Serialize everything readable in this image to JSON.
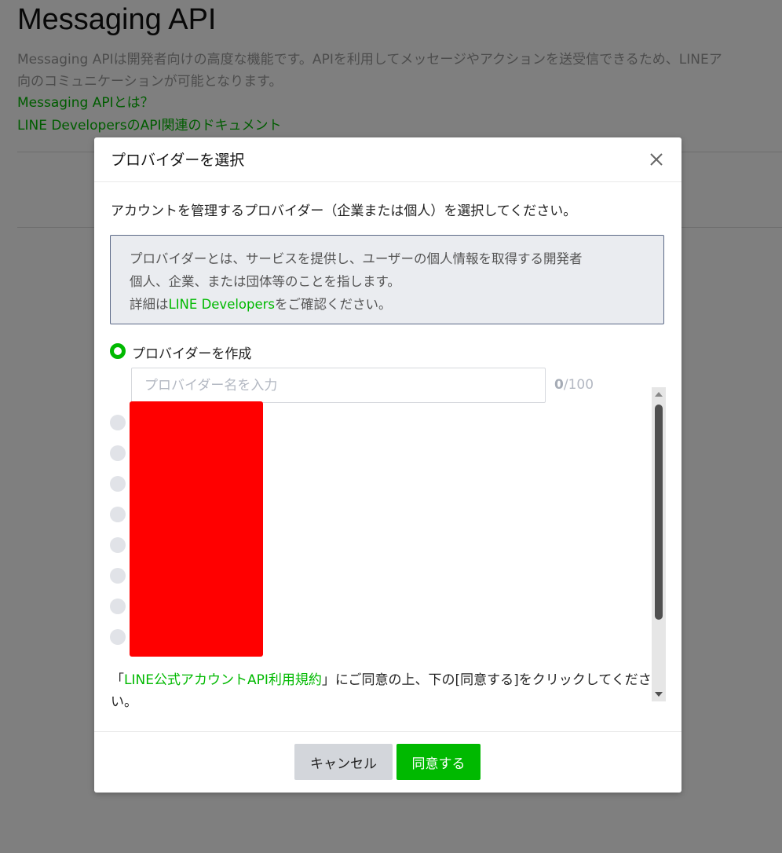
{
  "background": {
    "title": "Messaging API",
    "description_line1": "Messaging APIは開発者向けの高度な機能です。APIを利用してメッセージやアクションを送受信できるため、LINEア",
    "description_line2": "向のコミュニケーションが可能となります。",
    "links": [
      {
        "label": "Messaging APIとは？"
      },
      {
        "label": "LINE DevelopersのAPI関連のドキュメント"
      }
    ]
  },
  "modal": {
    "title": "プロバイダーを選択",
    "close_icon": "close-icon",
    "intro": "アカウントを管理するプロバイダー（企業または個人）を選択してください。",
    "info": {
      "line1": "プロバイダーとは、サービスを提供し、ユーザーの個人情報を取得する開発者",
      "line2": "個人、企業、または団体等のことを指します。",
      "line3_prefix": "詳細は",
      "line3_link": "LINE Developers",
      "line3_suffix": "をご確認ください。"
    },
    "create_option": {
      "label": "プロバイダーを作成",
      "selected": true,
      "input_value": "",
      "input_placeholder": "プロバイダー名を入力",
      "counter_current": "0",
      "counter_max": "/100"
    },
    "existing_providers_count_visible": 8,
    "terms": {
      "open_quote": "「",
      "link": "LINE公式アカウントAPI利用規約",
      "rest": "」にご同意の上、下の[同意する]をクリックしてください。"
    },
    "buttons": {
      "cancel": "キャンセル",
      "agree": "同意する"
    }
  },
  "colors": {
    "accent": "#00b900",
    "overlay": "rgba(0,0,0,0.5)",
    "redaction": "#ff0000"
  }
}
